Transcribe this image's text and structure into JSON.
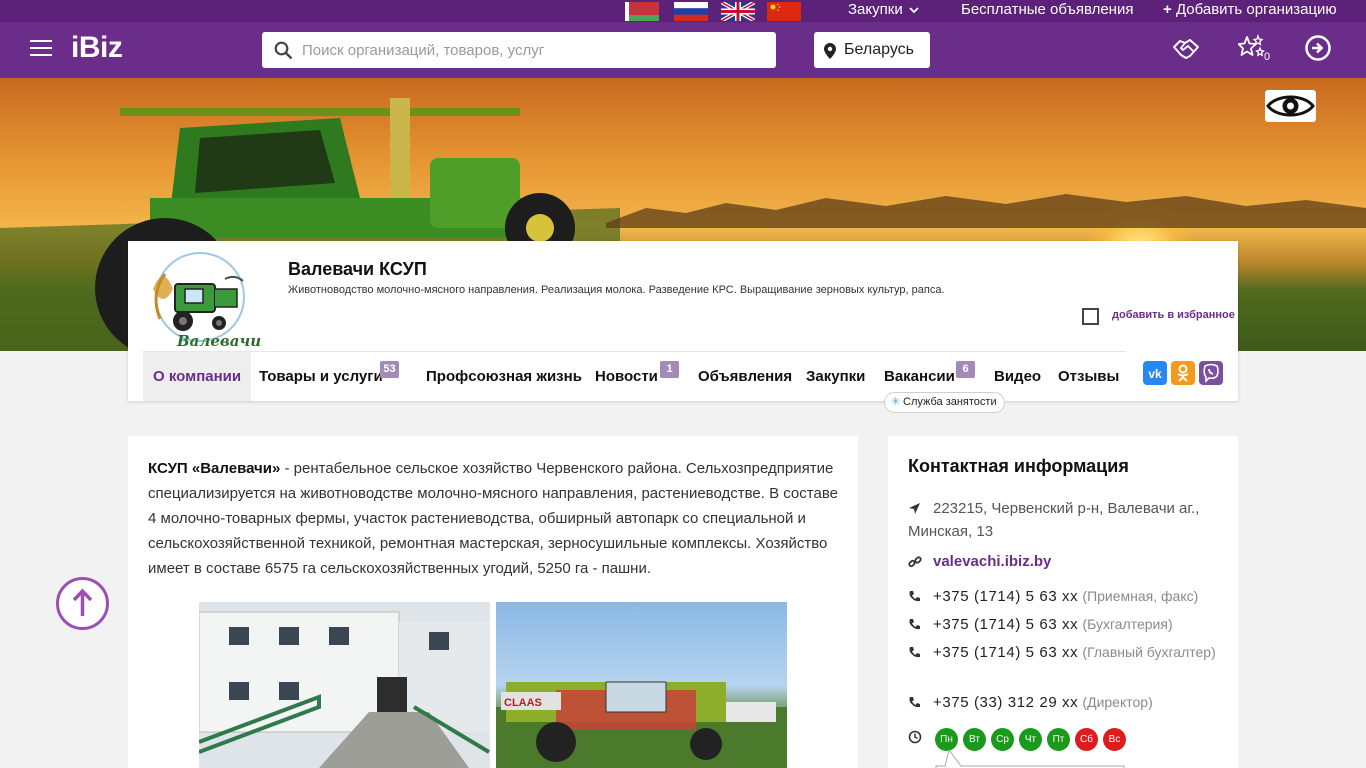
{
  "topbar": {
    "flags": [
      "by-flag",
      "ru-flag",
      "uk-flag",
      "cn-flag"
    ],
    "procurement_label": "Закупки",
    "free_ads_label": "Бесплатные объявления",
    "add_org_label": "Добавить организацию"
  },
  "header": {
    "logo": "iBiz",
    "search_placeholder": "Поиск организаций, товаров, услуг",
    "region_label": "Беларусь",
    "favorites_count": "0",
    "brand_color": "#6b2d8a"
  },
  "company": {
    "logo_text": "Валевачи",
    "name": "Валевачи КСУП",
    "description": "Животноводство молочно-мясного направления. Реализация молока. Разведение КРС. Выращивание зерновых культур, рапса.",
    "add_favorite_label": "добавить в избранное"
  },
  "nav": {
    "items": [
      {
        "label": "О компании",
        "badge": ""
      },
      {
        "label": "Товары и услуги",
        "badge": "53"
      },
      {
        "label": "Профсоюзная жизнь",
        "badge": ""
      },
      {
        "label": "Новости",
        "badge": "1"
      },
      {
        "label": "Объявления",
        "badge": ""
      },
      {
        "label": "Закупки",
        "badge": ""
      },
      {
        "label": "Вакансии",
        "badge": "6"
      },
      {
        "label": "Видео",
        "badge": ""
      },
      {
        "label": "Отзывы",
        "badge": ""
      }
    ],
    "employment_tag": "Служба занятости"
  },
  "about": {
    "company_bold": "КСУП «Валевачи»",
    "text": " - рентабельное сельское хозяйство Червенского района. Сельхозпредприятие специализируется на животноводстве молочно-мясного направления, растениеводстве. В составе 4 молочно-товарных фермы, участок растениеводства, обширный автопарк со специальной и сельскохозяйственной техникой, ремонтная мастерская, зерносушильные комплексы. Хозяйство имеет в составе 6575 га сельскохозяйственных угодий, 5250 га - пашни."
  },
  "contacts": {
    "title": "Контактная информация",
    "address": "223215, Червенский р-н, Валевачи аг., Минская, 13",
    "website": "valevachi.ibiz.by",
    "phones": [
      {
        "number": "+375 (1714) 5 63 xx",
        "note": "(Приемная, факс)"
      },
      {
        "number": "+375 (1714) 5 63 xx",
        "note": "(Бухгалтерия)"
      },
      {
        "number": "+375 (1714) 5 63 xx",
        "note": "(Главный бухгалтер)"
      },
      {
        "number": "+375 (33) 312 29 xx",
        "note": "(Директор)"
      }
    ],
    "days": [
      {
        "label": "Пн",
        "color": "#1a9a1a"
      },
      {
        "label": "Вт",
        "color": "#1a9a1a"
      },
      {
        "label": "Ср",
        "color": "#1a9a1a"
      },
      {
        "label": "Чт",
        "color": "#1a9a1a"
      },
      {
        "label": "Пт",
        "color": "#1a9a1a"
      },
      {
        "label": "Сб",
        "color": "#e01b1b"
      },
      {
        "label": "Вс",
        "color": "#e01b1b"
      }
    ]
  }
}
